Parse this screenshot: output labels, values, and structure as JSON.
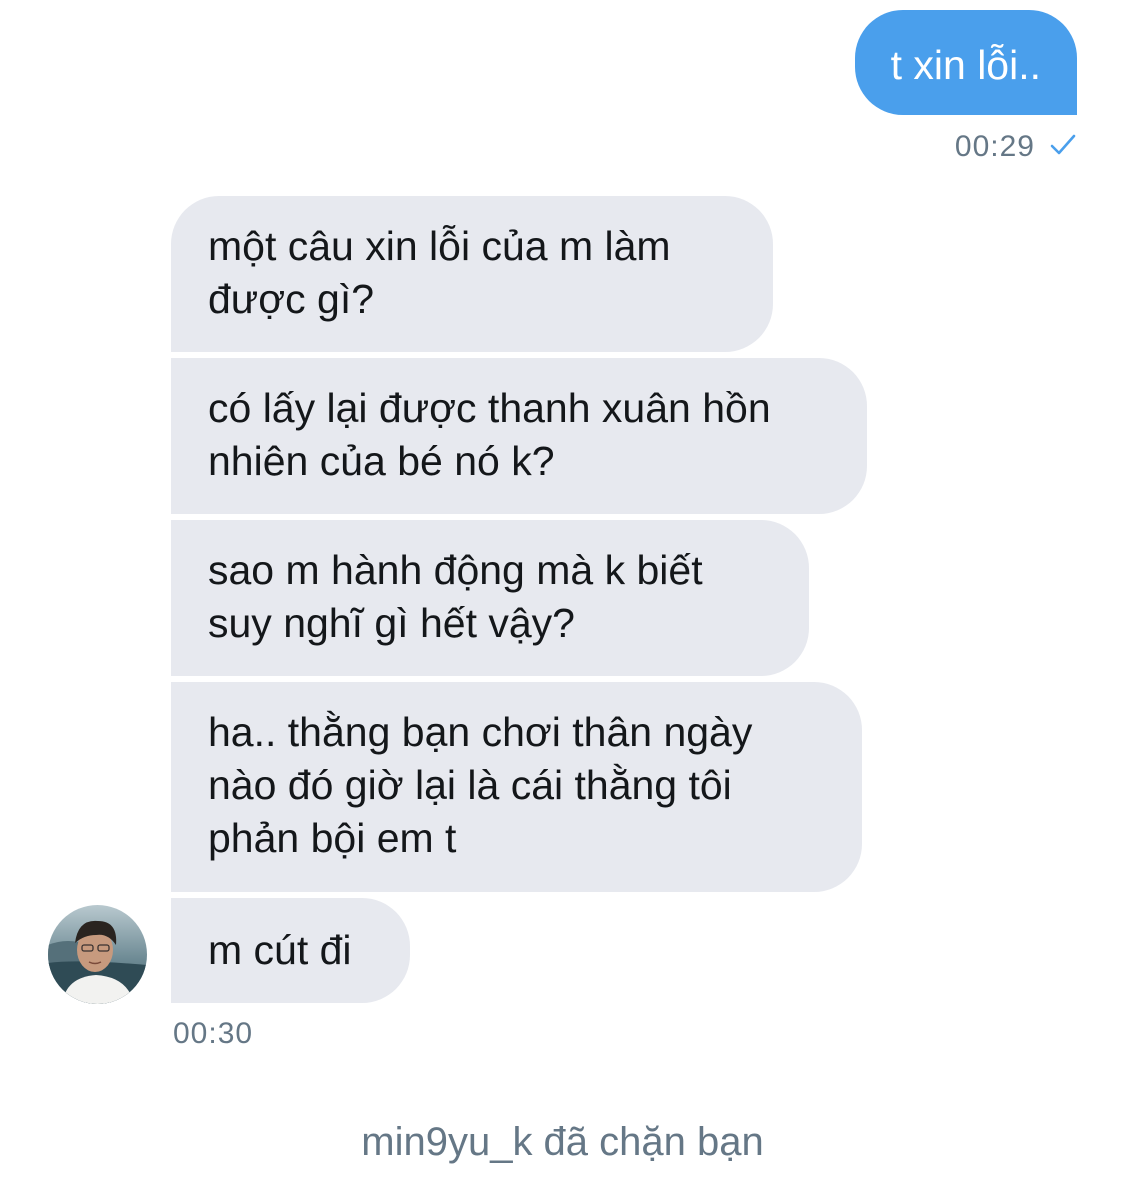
{
  "outgoing": {
    "text": "t xin lỗi..",
    "time": "00:29",
    "status_icon": "checkmark-icon"
  },
  "incoming": {
    "messages": [
      "một câu xin lỗi của m làm\nđược gì?",
      "có lấy lại được thanh xuân hồn\nnhiên của bé nó k?",
      "sao m hành động mà k biết\nsuy nghĩ gì hết vậy?",
      "ha.. thằng bạn chơi thân ngày\nnào đó giờ lại là cái thằng tôi\nphản bội em t",
      "m cút đi"
    ],
    "time": "00:30",
    "avatar_icon": "user-avatar-photo"
  },
  "footer": {
    "blocked_notice": "min9yu_k đã chặn bạn"
  },
  "colors": {
    "outgoing_bubble": "#4a9fec",
    "incoming_bubble": "#e7e9ef",
    "meta_text": "#657786"
  }
}
